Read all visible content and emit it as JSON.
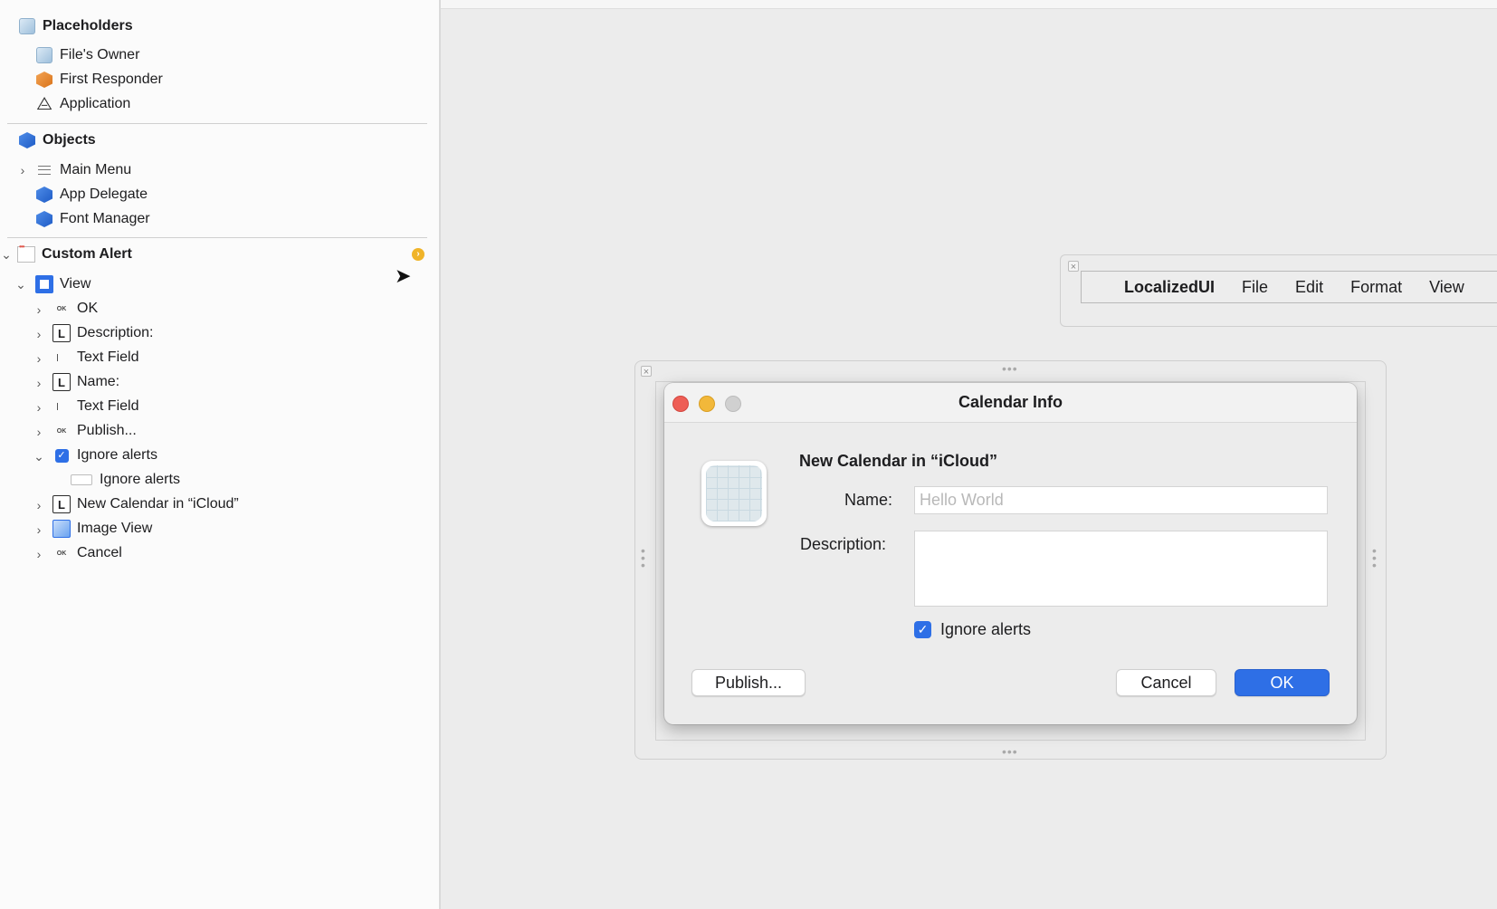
{
  "outline": {
    "placeholders_header": "Placeholders",
    "placeholders": [
      {
        "label": "File's Owner",
        "icon": "placeholder-cube-icon"
      },
      {
        "label": "First Responder",
        "icon": "first-responder-icon"
      },
      {
        "label": "Application",
        "icon": "application-icon"
      }
    ],
    "objects_header": "Objects",
    "objects": [
      {
        "label": "Main Menu",
        "icon": "menu-icon"
      },
      {
        "label": "App Delegate",
        "icon": "object-cube-icon"
      },
      {
        "label": "Font Manager",
        "icon": "object-cube-icon"
      }
    ],
    "custom_alert": "Custom Alert",
    "view": "View",
    "view_children": [
      {
        "label": "OK",
        "icon": "button-icon"
      },
      {
        "label": "Description:",
        "icon": "label-icon"
      },
      {
        "label": "Text Field",
        "icon": "text-field-icon"
      },
      {
        "label": "Name:",
        "icon": "label-icon"
      },
      {
        "label": "Text Field",
        "icon": "text-field-icon"
      },
      {
        "label": "Publish...",
        "icon": "button-icon"
      },
      {
        "label": "Ignore alerts",
        "icon": "checkbox-icon"
      },
      {
        "label": "Ignore alerts",
        "icon": "button-cell-icon"
      },
      {
        "label": "New Calendar in “iCloud”",
        "icon": "label-icon"
      },
      {
        "label": "Image View",
        "icon": "image-view-icon"
      },
      {
        "label": "Cancel",
        "icon": "button-icon"
      }
    ],
    "button_badge": "OK",
    "label_badge": "L"
  },
  "menubar": {
    "app_name": "LocalizedUI",
    "items": [
      "File",
      "Edit",
      "Format",
      "View"
    ]
  },
  "window": {
    "title": "Calendar Info",
    "heading": "New Calendar in “iCloud”",
    "name_label": "Name:",
    "name_placeholder": "Hello World",
    "description_label": "Description:",
    "checkbox_label": "Ignore alerts",
    "checkbox_checked": true,
    "publish_button": "Publish...",
    "cancel_button": "Cancel",
    "ok_button": "OK"
  },
  "colors": {
    "accent": "#2e6fe6",
    "close": "#ee5e56",
    "minimize": "#f2b83a",
    "zoom": "#d0d0d0",
    "warning": "#f0b429"
  }
}
